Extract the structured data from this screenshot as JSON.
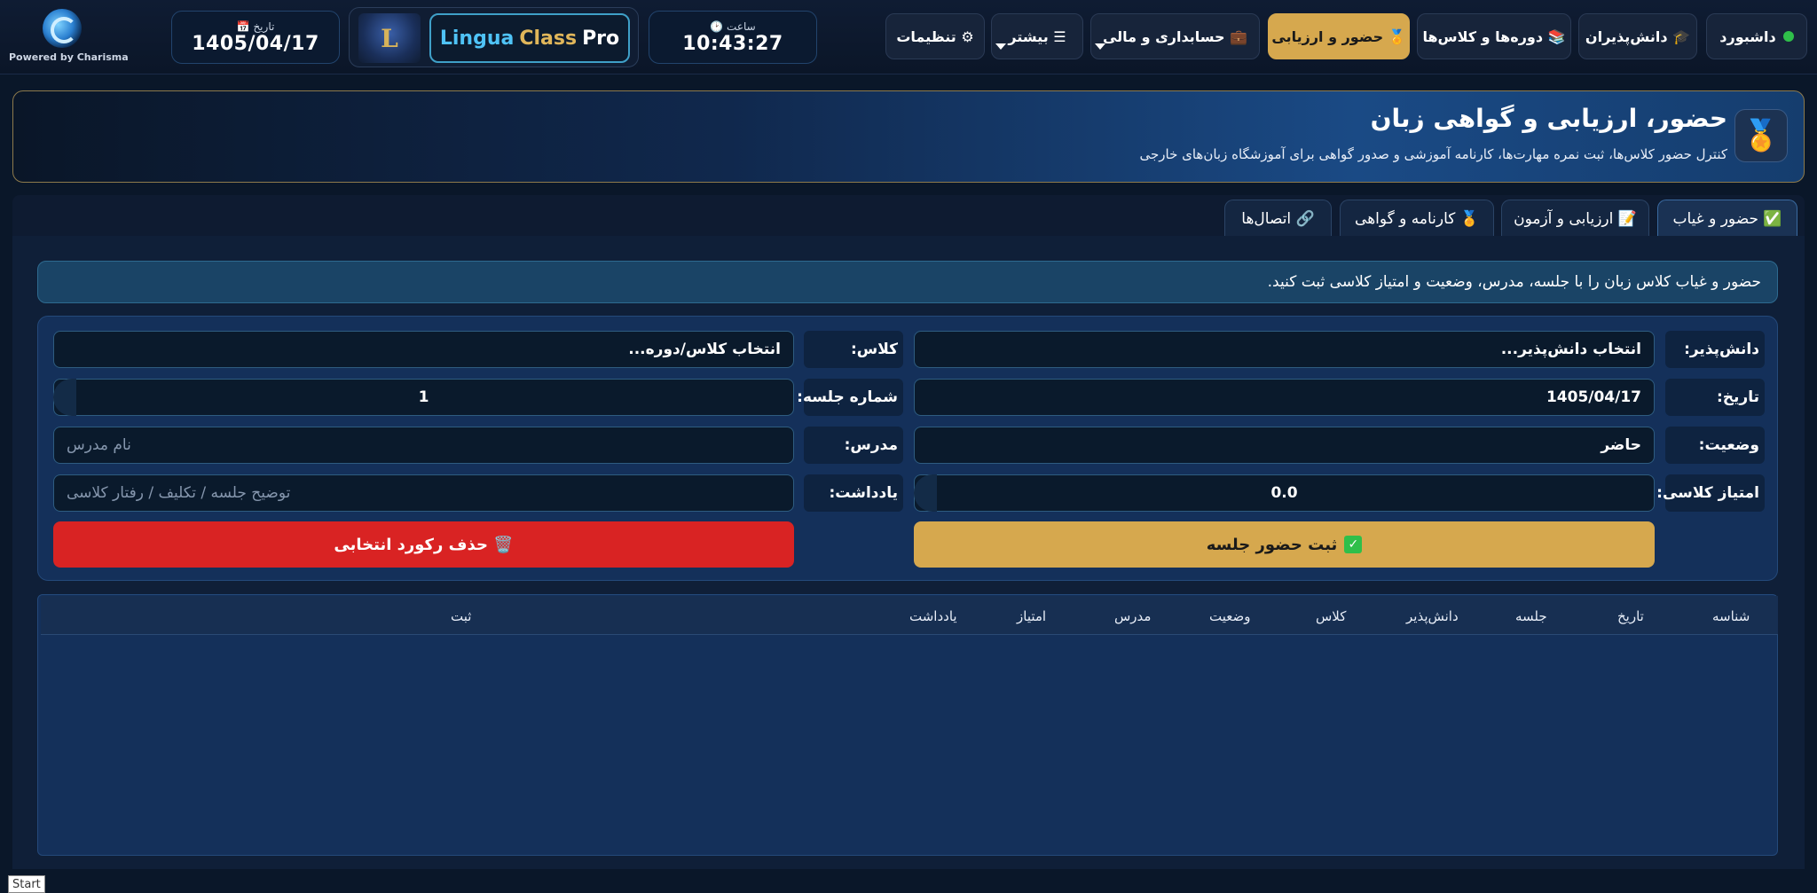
{
  "brand": {
    "powered_by": "Powered by Charisma"
  },
  "date_pill": {
    "label": "📅 تاریخ",
    "value": "1405/04/17"
  },
  "clock_pill": {
    "label": "🕑 ساعت",
    "value": "10:43:27"
  },
  "logo": {
    "name_part1": "Lingua",
    "name_part2": "Class",
    "name_part3": "Pro",
    "emblem": "L"
  },
  "nav": {
    "dashboard": "داشبورد",
    "students": "🎓 دانش‌پذیران",
    "courses": "📚 دوره‌ها و کلاس‌ها",
    "attendance": "🏅 حضور و ارزیابی",
    "accounting": "💼 حسابداری و مالی",
    "more": "☰ بیشتر",
    "settings": "⚙ تنظیمات"
  },
  "header": {
    "icon": "🏅",
    "title": "حضور، ارزیابی و گواهی زبان",
    "subtitle": "کنترل حضور کلاس‌ها، ثبت نمره مهارت‌ها، کارنامه آموزشی و صدور گواهی برای آموزشگاه زبان‌های خارجی"
  },
  "tabs": [
    {
      "label": "✅ حضور و غیاب"
    },
    {
      "label": "📝 ارزیابی و آزمون"
    },
    {
      "label": "🏅 کارنامه و گواهی"
    },
    {
      "label": "🔗 اتصال‌ها"
    }
  ],
  "info_text": "حضور و غیاب کلاس زبان را با جلسه، مدرس، وضعیت و امتیاز کلاسی ثبت کنید.",
  "form": {
    "student_label": "دانش‌پذیر:",
    "student_value": "انتخاب دانش‌پذیر...",
    "class_label": "کلاس:",
    "class_value": "انتخاب کلاس/دوره...",
    "date_label": "تاریخ:",
    "date_value": "1405/04/17",
    "session_label": "شماره جلسه:",
    "session_value": "1",
    "status_label": "وضعیت:",
    "status_value": "حاضر",
    "teacher_label": "مدرس:",
    "teacher_placeholder": "نام مدرس",
    "score_label": "امتیاز کلاسی:",
    "score_value": "0.0",
    "note_label": "یادداشت:",
    "note_placeholder": "توضیح جلسه / تکلیف / رفتار کلاسی",
    "save_button": "ثبت حضور جلسه",
    "delete_button": "🗑️ حذف رکورد انتخابی"
  },
  "table": {
    "columns": [
      "شناسه",
      "تاریخ",
      "جلسه",
      "دانش‌پذیر",
      "کلاس",
      "وضعیت",
      "مدرس",
      "امتیاز",
      "یادداشت",
      "ثبت"
    ],
    "rows": []
  },
  "taskbar": {
    "start": "Start"
  },
  "colors": {
    "accent_gold": "#d6a84e",
    "danger_red": "#d92323",
    "background": "#0a1729",
    "online_green": "#2fbf4a"
  }
}
